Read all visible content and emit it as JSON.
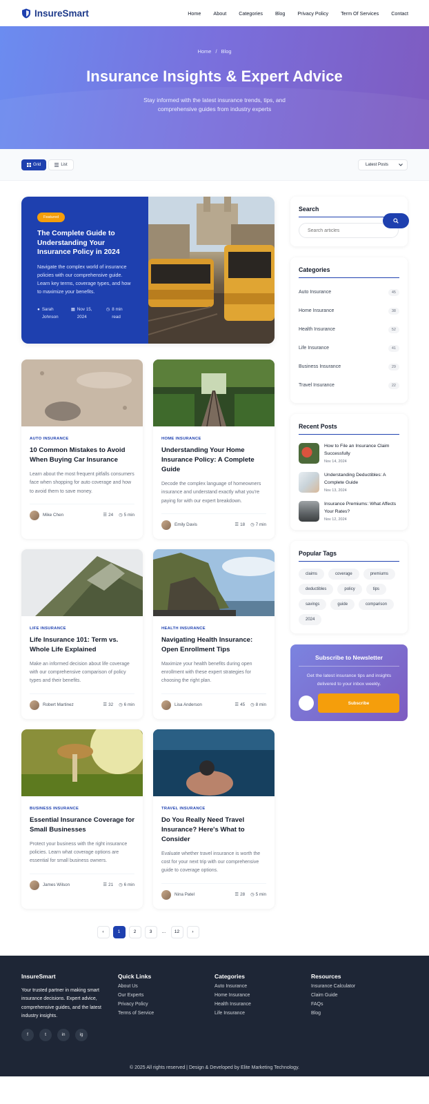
{
  "brand": {
    "name": "InsureSmart",
    "primary": "#1e40af",
    "accent": "#f59e0b"
  },
  "nav": {
    "links": [
      "Home",
      "About",
      "Categories",
      "Blog",
      "Privacy Policy",
      "Term Of Services",
      "Contact"
    ]
  },
  "hero": {
    "breadcrumb": [
      "Home",
      "Blog"
    ],
    "breadcrumb_separator": "/",
    "title": "Insurance Insights & Expert Advice",
    "subtitle": "Stay informed with the latest insurance trends, tips, and comprehensive guides from industry experts"
  },
  "toolbar": {
    "grid_label": "Grid",
    "list_label": "List",
    "sort_value": "Latest Posts"
  },
  "featured": {
    "badge": "Featured",
    "title": "The Complete Guide to Understanding Your Insurance Policy in 2024",
    "description": "Navigate the complex world of insurance policies with our comprehensive guide. Learn key terms, coverage types, and how to maximize your benefits.",
    "author": "Sarah Johnson",
    "date": "Nov 15, 2024",
    "read_time": "8 min read"
  },
  "posts": [
    {
      "category": "AUTO INSURANCE",
      "title": "10 Common Mistakes to Avoid When Buying Car Insurance",
      "excerpt": "Learn about the most frequent pitfalls consumers face when shopping for auto coverage and how to avoid them to save money.",
      "author": "Mike Chen",
      "comments": "24",
      "read": "5 min"
    },
    {
      "category": "HOME INSURANCE",
      "title": "Understanding Your Home Insurance Policy: A Complete Guide",
      "excerpt": "Decode the complex language of homeowners insurance and understand exactly what you're paying for with our expert breakdown.",
      "author": "Emily Davis",
      "comments": "18",
      "read": "7 min"
    },
    {
      "category": "LIFE INSURANCE",
      "title": "Life Insurance 101: Term vs. Whole Life Explained",
      "excerpt": "Make an informed decision about life coverage with our comprehensive comparison of policy types and their benefits.",
      "author": "Robert Martinez",
      "comments": "32",
      "read": "6 min"
    },
    {
      "category": "HEALTH INSURANCE",
      "title": "Navigating Health Insurance: Open Enrollment Tips",
      "excerpt": "Maximize your health benefits during open enrollment with these expert strategies for choosing the right plan.",
      "author": "Lisa Anderson",
      "comments": "45",
      "read": "8 min"
    },
    {
      "category": "BUSINESS INSURANCE",
      "title": "Essential Insurance Coverage for Small Businesses",
      "excerpt": "Protect your business with the right insurance policies. Learn what coverage options are essential for small business owners.",
      "author": "James Wilson",
      "comments": "21",
      "read": "6 min"
    },
    {
      "category": "TRAVEL INSURANCE",
      "title": "Do You Really Need Travel Insurance? Here's What to Consider",
      "excerpt": "Evaluate whether travel insurance is worth the cost for your next trip with our comprehensive guide to coverage options.",
      "author": "Nina Patel",
      "comments": "28",
      "read": "5 min"
    }
  ],
  "pagination": {
    "prev": "‹",
    "pages": [
      "1",
      "2",
      "3"
    ],
    "dots": "...",
    "last": "12",
    "next": "›"
  },
  "sidebar": {
    "search": {
      "title": "Search",
      "placeholder": "Search articles"
    },
    "categories": {
      "title": "Categories",
      "items": [
        {
          "name": "Auto Insurance",
          "count": "45"
        },
        {
          "name": "Home Insurance",
          "count": "38"
        },
        {
          "name": "Health Insurance",
          "count": "52"
        },
        {
          "name": "Life Insurance",
          "count": "41"
        },
        {
          "name": "Business Insurance",
          "count": "29"
        },
        {
          "name": "Travel Insurance",
          "count": "22"
        }
      ]
    },
    "recent": {
      "title": "Recent Posts",
      "items": [
        {
          "title": "How to File an Insurance Claim Successfully",
          "date": "Nov 14, 2024"
        },
        {
          "title": "Understanding Deductibles: A Complete Guide",
          "date": "Nov 13, 2024"
        },
        {
          "title": "Insurance Premiums: What Affects Your Rates?",
          "date": "Nov 12, 2024"
        }
      ]
    },
    "tags": {
      "title": "Popular Tags",
      "items": [
        "claims",
        "coverage",
        "premiums",
        "deductibles",
        "policy",
        "tips",
        "savings",
        "guide",
        "comparison",
        "2024"
      ]
    },
    "newsletter": {
      "title": "Subscribe to Newsletter",
      "description": "Get the latest insurance tips and insights delivered to your inbox weekly.",
      "button": "Subscribe"
    }
  },
  "footer": {
    "about": {
      "title": "InsureSmart",
      "text": "Your trusted partner in making smart insurance decisions. Expert advice, comprehensive guides, and the latest industry insights."
    },
    "social": [
      "f",
      "t",
      "in",
      "ig"
    ],
    "quick_links": {
      "title": "Quick Links",
      "items": [
        "About Us",
        "Our Experts",
        "Privacy Policy",
        "Terms of Service"
      ]
    },
    "categories": {
      "title": "Categories",
      "items": [
        "Auto Insurance",
        "Home Insurance",
        "Health Insurance",
        "Life Insurance"
      ]
    },
    "resources": {
      "title": "Resources",
      "items": [
        "Insurance Calculator",
        "Claim Guide",
        "FAQs",
        "Blog"
      ]
    },
    "copyright": "© 2025 All rights reserved | Design & Developed by Elite Marketing Technology."
  }
}
